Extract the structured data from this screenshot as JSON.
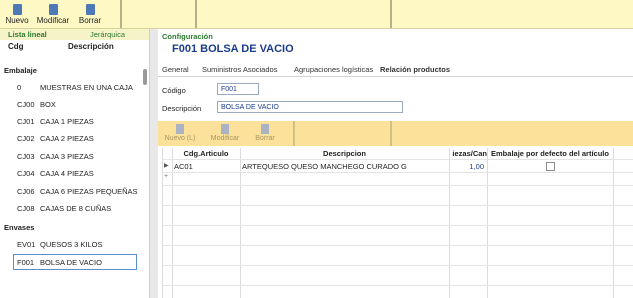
{
  "toolbar": {
    "buttons": [
      {
        "label": "Nuevo"
      },
      {
        "label": "Modificar"
      },
      {
        "label": "Borrar"
      }
    ]
  },
  "left_panel": {
    "tabs": [
      "Lista lineal",
      "Jerárquica"
    ],
    "columns": {
      "code": "Cdg",
      "description": "Descripción"
    },
    "groups": [
      {
        "name": "Embalaje",
        "items": [
          {
            "code": "0",
            "desc": "MUESTRAS EN UNA CAJA"
          },
          {
            "code": "CJ00",
            "desc": "BOX"
          },
          {
            "code": "CJ01",
            "desc": "CAJA 1 PIEZAS"
          },
          {
            "code": "CJ02",
            "desc": "CAJA 2 PIEZAS"
          },
          {
            "code": "CJ03",
            "desc": "CAJA 3 PIEZAS"
          },
          {
            "code": "CJ04",
            "desc": "CAJA 4 PIEZAS"
          },
          {
            "code": "CJ06",
            "desc": "CAJA 6 PIEZAS PEQUEÑAS"
          },
          {
            "code": "CJ08",
            "desc": "CAJAS DE 8 CUÑAS"
          }
        ]
      },
      {
        "name": "Envases",
        "items": [
          {
            "code": "EV01",
            "desc": "QUESOS 3 KILOS"
          },
          {
            "code": "F001",
            "desc": "BOLSA DE VACIO"
          }
        ]
      }
    ]
  },
  "detail": {
    "section_label": "Configuración",
    "title": "F001  BOLSA DE VACIO",
    "tabs": [
      "General",
      "Suministros Asociados",
      "Agrupaciones logísticas",
      "Relación productos"
    ],
    "active_tab": "Relación productos",
    "code_label": "Código",
    "code_value": "F001",
    "desc_label": "Descripción",
    "desc_value": "BOLSA DE VACIO",
    "inner_toolbar": [
      "Nuevo (L)",
      "Modificar",
      "Borrar"
    ],
    "grid": {
      "columns": [
        "Cdg.Articulo",
        "Descripcion",
        "iezas/Can",
        "Embalaje por defecto del artículo"
      ],
      "rows": [
        {
          "code": "AC01",
          "desc": "ARTEQUESO QUESO MANCHEGO  CURADO G",
          "qty": "1,00",
          "default": false
        }
      ],
      "new_row_marker": "+"
    }
  },
  "colors": {
    "toolbar_bg": "#fdf8c4",
    "inner_toolbar_bg": "#fbe19a",
    "title_color": "#1b3c8c",
    "section_label_color": "#2d7a2d"
  }
}
